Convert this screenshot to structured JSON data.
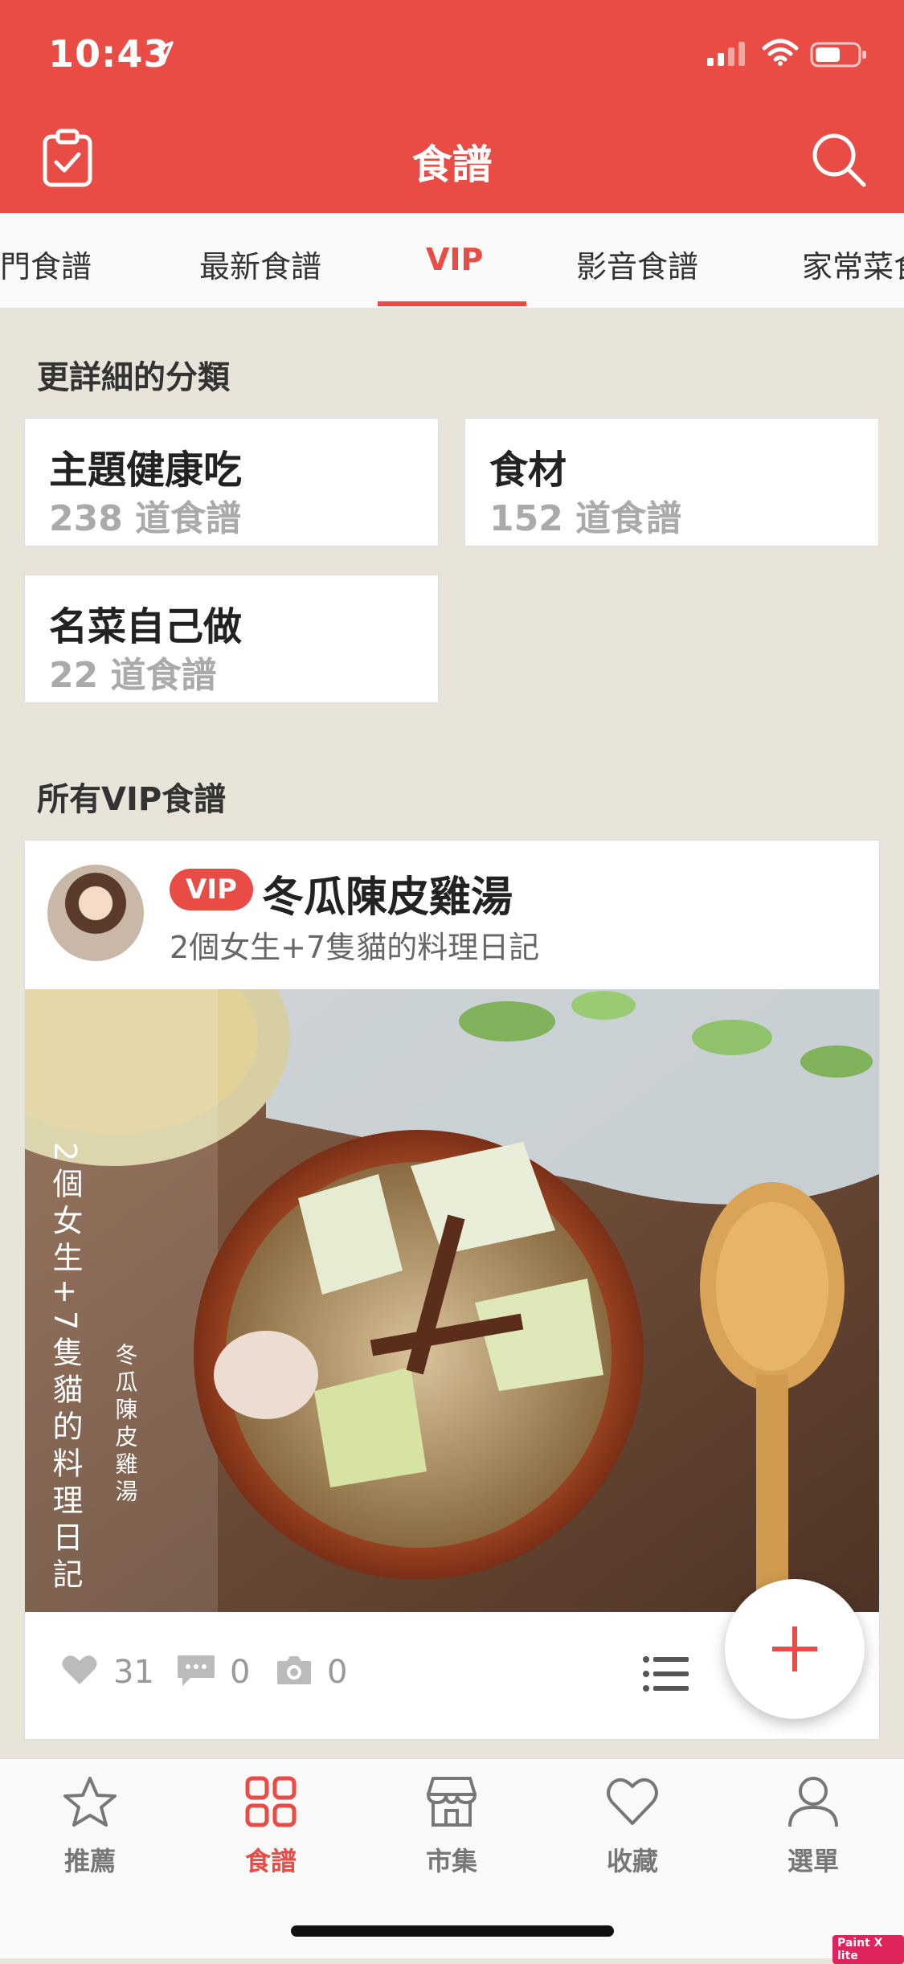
{
  "status_bar": {
    "time": "10:43"
  },
  "header": {
    "title": "食譜"
  },
  "tabs": [
    {
      "label": "熱門食譜"
    },
    {
      "label": "最新食譜"
    },
    {
      "label": "VIP"
    },
    {
      "label": "影音食譜"
    },
    {
      "label": "家常菜食譜"
    }
  ],
  "categories_section": {
    "title": "更詳細的分類"
  },
  "categories": [
    {
      "name": "主題健康吃",
      "count": "238 道食譜"
    },
    {
      "name": "食材",
      "count": "152 道食譜"
    },
    {
      "name": "名菜自己做",
      "count": "22 道食譜"
    }
  ],
  "vip_section": {
    "title": "所有VIP食譜"
  },
  "recipe": {
    "badge": "VIP",
    "title": "冬瓜陳皮雞湯",
    "author": "2個女生+7隻貓的料理日記",
    "photo_text_main": "2個女生+7隻貓的料理日記",
    "photo_text_sub": "冬瓜陳皮雞湯",
    "likes": "31",
    "comments": "0",
    "photos": "0"
  },
  "bottom_nav": [
    {
      "label": "推薦",
      "icon": "star-icon"
    },
    {
      "label": "食譜",
      "icon": "grid-icon"
    },
    {
      "label": "市集",
      "icon": "store-icon"
    },
    {
      "label": "收藏",
      "icon": "heart-icon"
    },
    {
      "label": "選單",
      "icon": "user-icon"
    }
  ],
  "watermark": "Paint X lite",
  "colors": {
    "brand": "#e94c44",
    "background": "#e8e4da"
  }
}
